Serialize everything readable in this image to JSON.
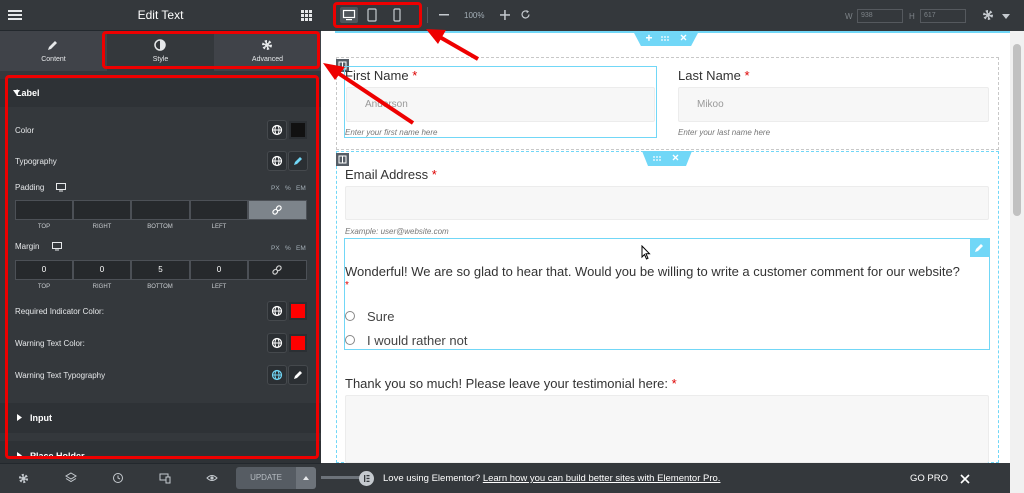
{
  "panel": {
    "title": "Edit Text",
    "tabs": [
      {
        "label": "Content",
        "icon": "pencil-icon"
      },
      {
        "label": "Style",
        "icon": "contrast-icon"
      },
      {
        "label": "Advanced",
        "icon": "gear-icon"
      }
    ],
    "active_tab": "Style",
    "label_section": {
      "title": "Label",
      "color_label": "Color",
      "color_value": "#111111",
      "typography_label": "Typography",
      "padding": {
        "label": "Padding",
        "units": [
          "PX",
          "%",
          "EM"
        ],
        "values": [
          "",
          "",
          "",
          ""
        ],
        "sides": [
          "TOP",
          "RIGHT",
          "BOTTOM",
          "LEFT"
        ]
      },
      "margin": {
        "label": "Margin",
        "units": [
          "PX",
          "%",
          "EM"
        ],
        "values": [
          "0",
          "0",
          "5",
          "0"
        ],
        "sides": [
          "TOP",
          "RIGHT",
          "BOTTOM",
          "LEFT"
        ]
      },
      "required_color_label": "Required Indicator Color:",
      "required_color_value": "#ff0000",
      "warning_color_label": "Warning Text Color:",
      "warning_color_value": "#ff0000",
      "warning_typography_label": "Warning Text Typography"
    },
    "input_section": {
      "title": "Input"
    },
    "next_section": {
      "title": "Place Holder"
    },
    "footer": {
      "update_label": "UPDATE"
    }
  },
  "topbar": {
    "zoom": "100%",
    "width_label": "W",
    "width_value": "938",
    "height_label": "H",
    "height_value": "617"
  },
  "form": {
    "first_name": {
      "label": "First Name",
      "required": "*",
      "value": "Anderson",
      "hint": "Enter your first name here"
    },
    "last_name": {
      "label": "Last Name",
      "required": "*",
      "value": "Mikoo",
      "hint": "Enter your last name here"
    },
    "email": {
      "label": "Email Address",
      "required": "*",
      "value": "",
      "hint": "Example: user@website.com"
    },
    "question": {
      "text": "Wonderful! We are so glad to hear that. Would you be willing to write a customer comment for our website?",
      "required": "*",
      "options": [
        "Sure",
        "I would rather not"
      ]
    },
    "testimonial": {
      "label": "Thank you so much! Please leave your testimonial here:",
      "required": "*"
    }
  },
  "promo": {
    "text": "Love using Elementor?",
    "link_text": "Learn how you can build better sites with Elementor Pro.",
    "go_pro": "GO PRO"
  },
  "colors": {
    "annotation_red": "#e00000",
    "panel_bg": "#34383c",
    "selection_blue": "#71d7f7"
  }
}
